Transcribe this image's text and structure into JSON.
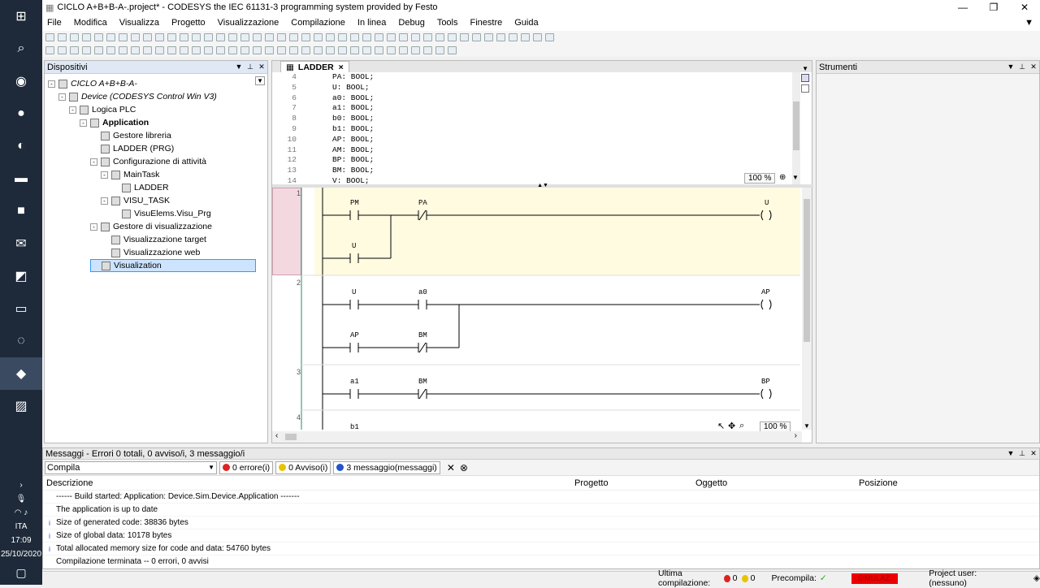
{
  "window": {
    "title": "CICLO A+B+B-A-.project* - CODESYS the IEC 61131-3 programming system provided by Festo"
  },
  "menu": [
    "File",
    "Modifica",
    "Visualizza",
    "Progetto",
    "Visualizzazione",
    "Compilazione",
    "In linea",
    "Debug",
    "Tools",
    "Finestre",
    "Guida"
  ],
  "devices": {
    "title": "Dispositivi",
    "items": [
      {
        "label": "CICLO A+B+B-A-",
        "depth": 0,
        "style": "italic",
        "exp": "-"
      },
      {
        "label": "Device (CODESYS Control Win V3)",
        "depth": 1,
        "style": "italic",
        "exp": "-"
      },
      {
        "label": "Logica PLC",
        "depth": 2,
        "style": "",
        "exp": "-"
      },
      {
        "label": "Application",
        "depth": 3,
        "style": "bold",
        "exp": "-"
      },
      {
        "label": "Gestore libreria",
        "depth": 4,
        "style": "",
        "exp": ""
      },
      {
        "label": "LADDER (PRG)",
        "depth": 4,
        "style": "",
        "exp": ""
      },
      {
        "label": "Configurazione di attività",
        "depth": 4,
        "style": "",
        "exp": "-"
      },
      {
        "label": "MainTask",
        "depth": 5,
        "style": "",
        "exp": "-"
      },
      {
        "label": "LADDER",
        "depth": 6,
        "style": "",
        "exp": ""
      },
      {
        "label": "VISU_TASK",
        "depth": 5,
        "style": "",
        "exp": "-"
      },
      {
        "label": "VisuElems.Visu_Prg",
        "depth": 6,
        "style": "",
        "exp": ""
      },
      {
        "label": "Gestore di visualizzazione",
        "depth": 4,
        "style": "",
        "exp": "-"
      },
      {
        "label": "Visualizzazione target",
        "depth": 5,
        "style": "",
        "exp": ""
      },
      {
        "label": "Visualizzazione web",
        "depth": 5,
        "style": "",
        "exp": ""
      },
      {
        "label": "Visualization",
        "depth": 4,
        "style": "sel",
        "exp": ""
      }
    ]
  },
  "editor": {
    "tab": "LADDER",
    "tab_close": "×",
    "decl": [
      {
        "ln": "4",
        "code": "PA: BOOL;"
      },
      {
        "ln": "5",
        "code": "U: BOOL;"
      },
      {
        "ln": "6",
        "code": "a0: BOOL;"
      },
      {
        "ln": "7",
        "code": "a1: BOOL;"
      },
      {
        "ln": "8",
        "code": "b0: BOOL;"
      },
      {
        "ln": "9",
        "code": "b1: BOOL;"
      },
      {
        "ln": "10",
        "code": "AP: BOOL;"
      },
      {
        "ln": "11",
        "code": "AM: BOOL;"
      },
      {
        "ln": "12",
        "code": "BP: BOOL;"
      },
      {
        "ln": "13",
        "code": "BM: BOOL;"
      },
      {
        "ln": "14",
        "code": "V: BOOL;"
      }
    ],
    "zoom_decl": "100 %",
    "zoom_ladder": "100 %",
    "networks": [
      "1",
      "2",
      "3",
      "4"
    ],
    "labels": {
      "n1_c1": "PM",
      "n1_c2": "PA",
      "n1_coil": "U",
      "n1_p": "U",
      "n2_c1": "U",
      "n2_c2": "a0",
      "n2_coil": "AP",
      "n2_p1": "AP",
      "n2_p2": "BM",
      "n3_c1": "a1",
      "n3_c2": "BM",
      "n3_coil": "BP",
      "n4_c1": "b1"
    }
  },
  "tools": {
    "title": "Strumenti"
  },
  "messages": {
    "title": "Messaggi - Errori 0 totali, 0 avviso/i, 3 messaggio/i",
    "category": "Compila",
    "errors": "0 errore(i)",
    "warnings": "0 Avviso(i)",
    "infos": "3 messaggio(messaggi)",
    "columns": [
      "Descrizione",
      "Progetto",
      "Oggetto",
      "Posizione"
    ],
    "rows": [
      {
        "icon": "",
        "text": "------ Build started: Application: Device.Sim.Device.Application -------"
      },
      {
        "icon": "",
        "text": "The application is up to date"
      },
      {
        "icon": "i",
        "text": "Size of generated code: 38836 bytes"
      },
      {
        "icon": "i",
        "text": "Size of global data: 10178 bytes"
      },
      {
        "icon": "i",
        "text": "Total allocated memory size for code and data: 54760 bytes"
      },
      {
        "icon": "",
        "text": "Compilazione terminata -- 0 errori, 0 avvisi"
      }
    ]
  },
  "status": {
    "last_compile": "Ultima compilazione:",
    "err_count": "0",
    "warn_count": "0",
    "precompile": "Precompila:",
    "check": "✓",
    "sim": "SIMULAZ.",
    "user": "Project user: (nessuno)"
  },
  "taskbar": {
    "lang": "ITA",
    "time": "17:09",
    "date": "25/10/2020"
  }
}
